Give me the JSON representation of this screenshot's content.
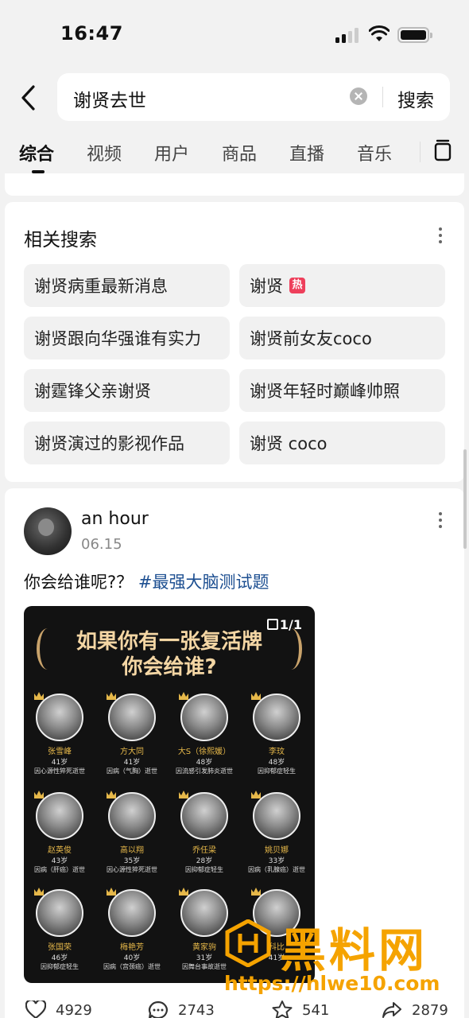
{
  "status_bar": {
    "time": "16:47"
  },
  "search": {
    "query": "谢贤去世",
    "button_label": "搜索"
  },
  "tabs": [
    "综合",
    "视频",
    "用户",
    "商品",
    "直播",
    "音乐"
  ],
  "related": {
    "title": "相关搜索",
    "items": [
      {
        "label": "谢贤病重最新消息"
      },
      {
        "label": "谢贤",
        "badge": "热"
      },
      {
        "label": "谢贤跟向华强谁有实力"
      },
      {
        "label": "谢贤前女友coco"
      },
      {
        "label": "谢霆锋父亲谢贤"
      },
      {
        "label": "谢贤年轻时巅峰帅照"
      },
      {
        "label": "谢贤演过的影视作品"
      },
      {
        "label": "谢贤 coco"
      }
    ]
  },
  "post": {
    "author": "an hour",
    "date": "06.15",
    "text": "你会给谁呢?？",
    "hashtag": "#最强大脑测试题",
    "image": {
      "counter": "1/1",
      "headline_1": "如果你有一张复活牌",
      "headline_2": "你会给谁?",
      "people": [
        {
          "name": "张雪峰",
          "age": "41岁",
          "cause": "因心源性猝死逝世"
        },
        {
          "name": "方大同",
          "age": "41岁",
          "cause": "因病（气胸）逝世"
        },
        {
          "name": "大S（徐熙媛）",
          "age": "48岁",
          "cause": "因流感引发肺炎逝世"
        },
        {
          "name": "李玟",
          "age": "48岁",
          "cause": "因抑郁症轻生"
        },
        {
          "name": "赵英俊",
          "age": "43岁",
          "cause": "因病（肝癌）逝世"
        },
        {
          "name": "高以翔",
          "age": "35岁",
          "cause": "因心源性猝死逝世"
        },
        {
          "name": "乔任梁",
          "age": "28岁",
          "cause": "因抑郁症轻生"
        },
        {
          "name": "姚贝娜",
          "age": "33岁",
          "cause": "因病（乳腺癌）逝世"
        },
        {
          "name": "张国荣",
          "age": "46岁",
          "cause": "因抑郁症轻生"
        },
        {
          "name": "梅艳芳",
          "age": "40岁",
          "cause": "因病（宫颈癌）逝世"
        },
        {
          "name": "黄家驹",
          "age": "31岁",
          "cause": "因舞台事故逝世"
        },
        {
          "name": "科比",
          "age": "41岁",
          "cause": ""
        }
      ]
    },
    "actions": {
      "likes": "4929",
      "comments": "2743",
      "favorites": "541",
      "shares": "2879"
    }
  },
  "watermark": {
    "title": "黑料网",
    "url": "https://hlwe10.com"
  },
  "colors": {
    "hot_badge": "#ee3f5b",
    "hashtag": "#1d4f91",
    "watermark": "#f5a300"
  }
}
